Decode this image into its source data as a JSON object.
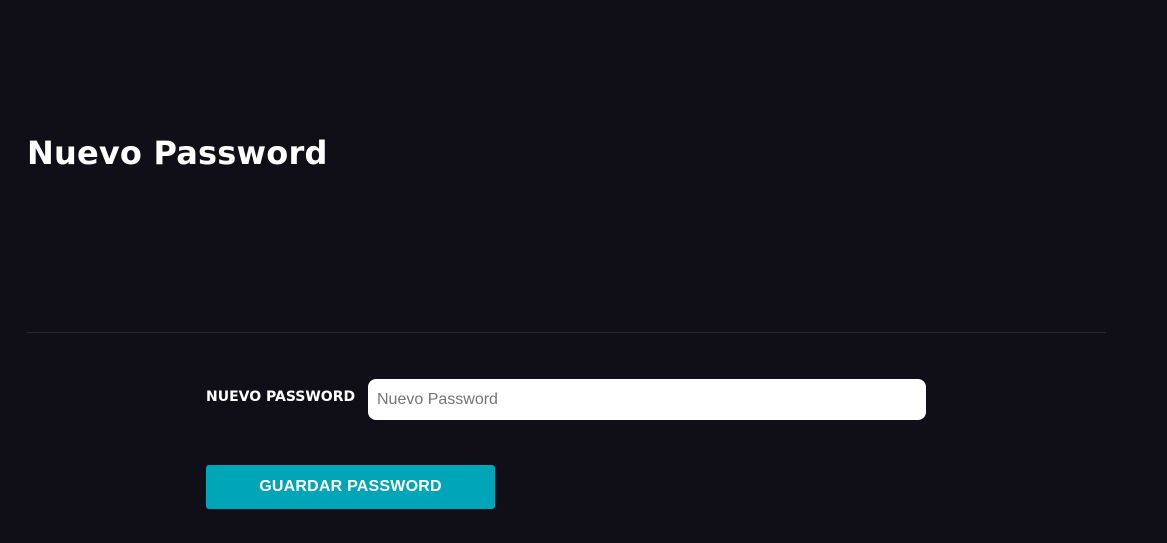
{
  "page": {
    "title": "Nuevo Password"
  },
  "form": {
    "password_label": "NUEVO PASSWORD",
    "password_placeholder": "Nuevo Password",
    "password_value": "",
    "submit_label": "GUARDAR PASSWORD"
  },
  "colors": {
    "background": "#100f17",
    "accent": "#00a5b8",
    "text": "#ffffff"
  }
}
